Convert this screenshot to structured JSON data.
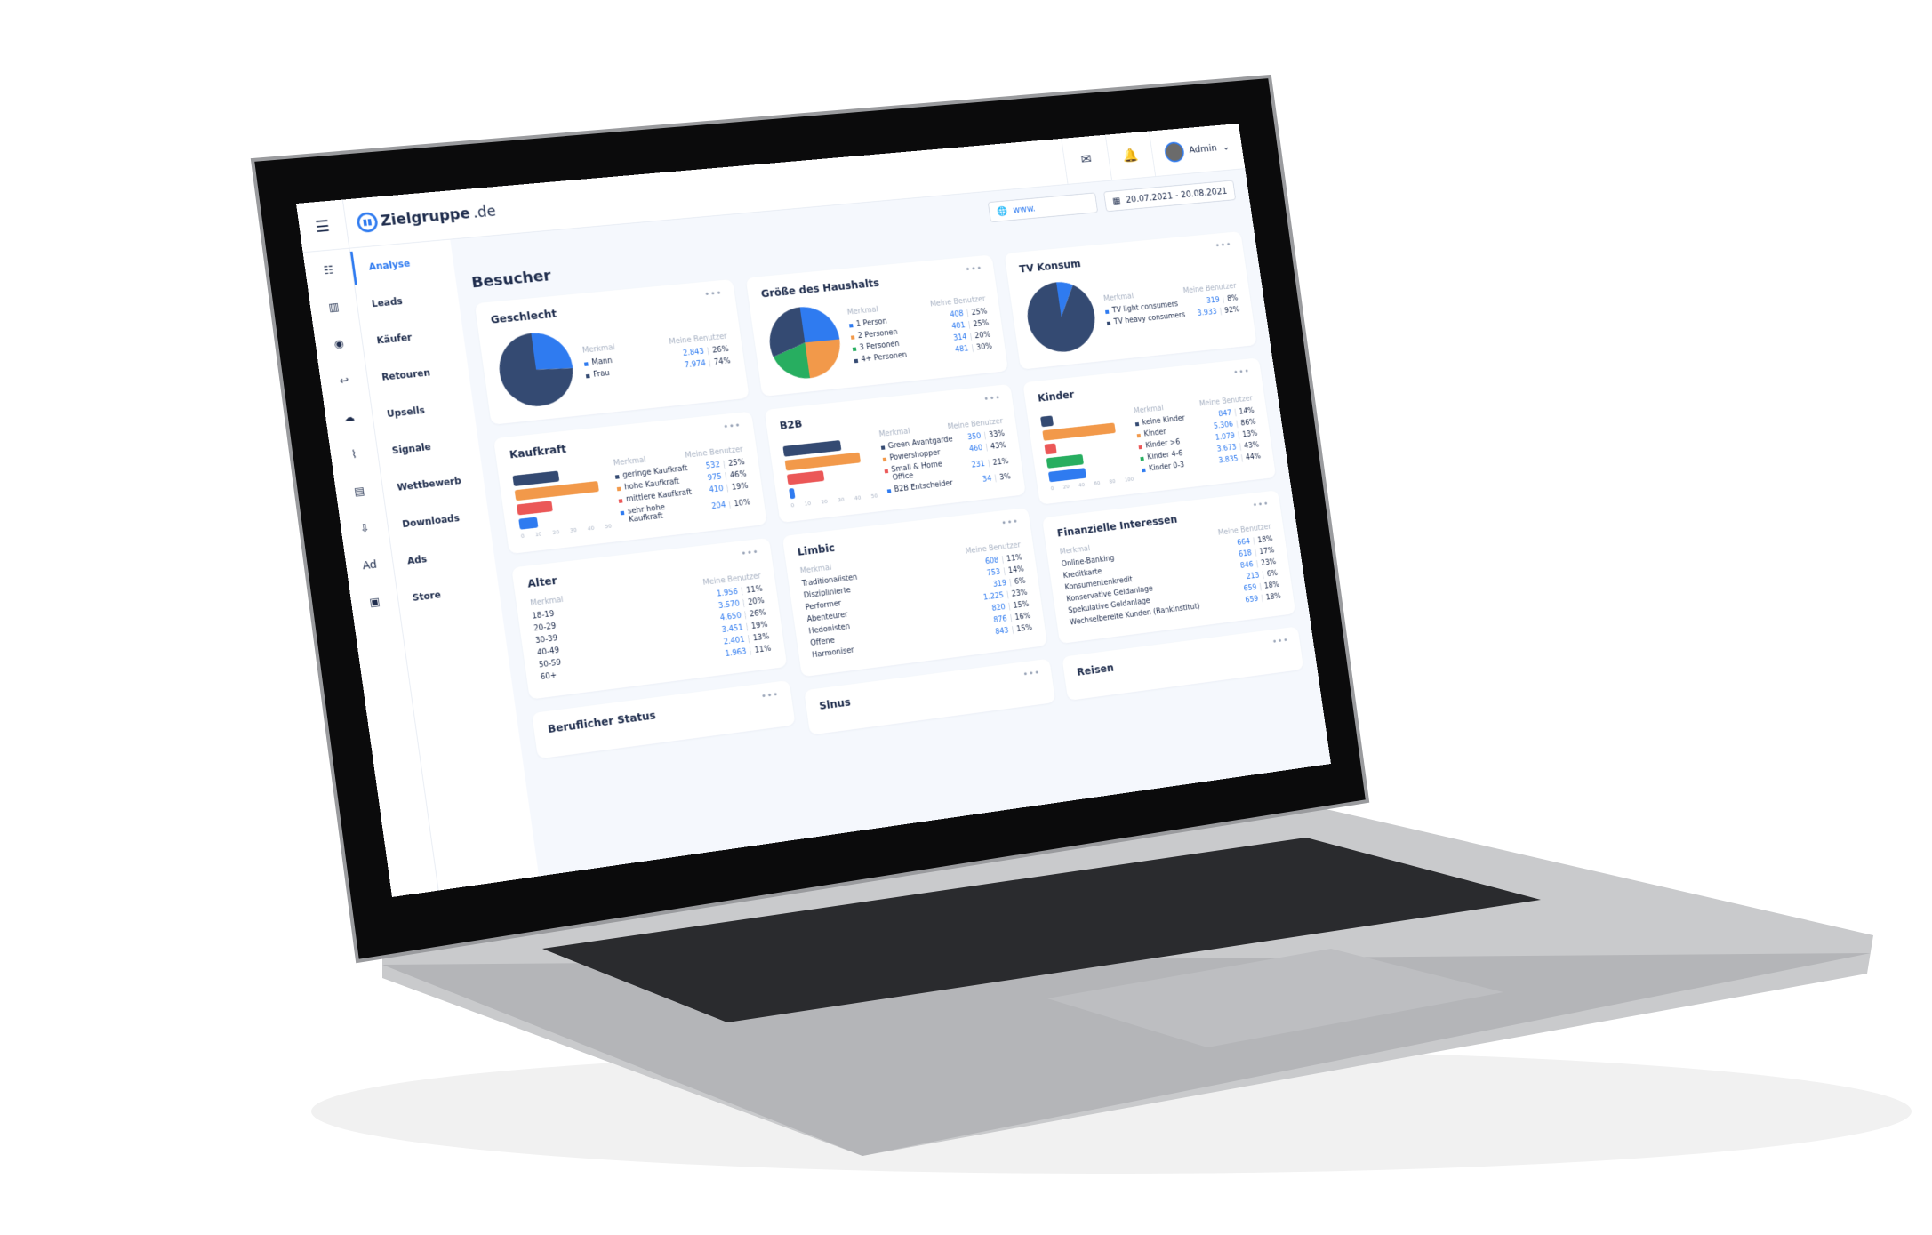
{
  "colors": {
    "navy": "#344a72",
    "blue": "#2f7bf0",
    "orange": "#f2994a",
    "green": "#27ae60",
    "red": "#eb5757"
  },
  "header": {
    "logo_name": "Zielgruppe",
    "logo_tld": ".de",
    "user": "Admin",
    "icons": [
      "menu-icon",
      "mail-icon",
      "bell-icon",
      "chevron-down-icon"
    ]
  },
  "filters": {
    "url_value": "www.",
    "date_range": "20.07.2021 - 20.08.2021"
  },
  "rail_icons": [
    "list-icon",
    "bar-chart-icon",
    "user-circle-icon",
    "return-icon",
    "cloud-icon",
    "signal-icon",
    "clipboard-icon",
    "download-icon",
    "ads-icon",
    "store-icon"
  ],
  "nav": [
    {
      "label": "Analyse",
      "active": true
    },
    {
      "label": "Leads"
    },
    {
      "label": "Käufer"
    },
    {
      "label": "Retouren"
    },
    {
      "label": "Upsells"
    },
    {
      "label": "Signale"
    },
    {
      "label": "Wettbewerb"
    },
    {
      "label": "Downloads"
    },
    {
      "label": "Ads"
    },
    {
      "label": "Store"
    }
  ],
  "page_title": "Besucher",
  "col_merkmal": "Merkmal",
  "col_users": "Meine Benutzer",
  "columns": [
    [
      {
        "title": "Geschlecht",
        "type": "pie",
        "rows": [
          {
            "label": "Mann",
            "count": "2.843",
            "pct": 26,
            "color": "blue"
          },
          {
            "label": "Frau",
            "count": "7.974",
            "pct": 74,
            "color": "navy"
          }
        ]
      },
      {
        "title": "Kaufkraft",
        "type": "bar",
        "ticks": [
          "0",
          "10",
          "20",
          "30",
          "40",
          "50"
        ],
        "max": 50,
        "rows": [
          {
            "label": "geringe Kaufkraft",
            "count": "532",
            "pct": 25,
            "color": "navy"
          },
          {
            "label": "hohe Kaufkraft",
            "count": "975",
            "pct": 46,
            "color": "orange"
          },
          {
            "label": "mittlere Kaufkraft",
            "count": "410",
            "pct": 19,
            "color": "red"
          },
          {
            "label": "sehr hohe Kaufkraft",
            "count": "204",
            "pct": 10,
            "color": "blue"
          }
        ]
      },
      {
        "title": "Alter",
        "type": "list",
        "rows": [
          {
            "label": "18-19",
            "count": "1.956",
            "pct": 11
          },
          {
            "label": "20-29",
            "count": "3.570",
            "pct": 20
          },
          {
            "label": "30-39",
            "count": "4.650",
            "pct": 26
          },
          {
            "label": "40-49",
            "count": "3.451",
            "pct": 19
          },
          {
            "label": "50-59",
            "count": "2.401",
            "pct": 13
          },
          {
            "label": "60+",
            "count": "1.963",
            "pct": 11
          }
        ]
      },
      {
        "title": "Beruflicher Status",
        "type": "empty",
        "rows": []
      }
    ],
    [
      {
        "title": "Größe des Haushalts",
        "type": "pie",
        "rows": [
          {
            "label": "1 Person",
            "count": "408",
            "pct": 25,
            "color": "blue"
          },
          {
            "label": "2 Personen",
            "count": "401",
            "pct": 25,
            "color": "orange"
          },
          {
            "label": "3 Personen",
            "count": "314",
            "pct": 20,
            "color": "green"
          },
          {
            "label": "4+ Personen",
            "count": "481",
            "pct": 30,
            "color": "navy"
          }
        ]
      },
      {
        "title": "B2B",
        "type": "bar",
        "ticks": [
          "0",
          "10",
          "20",
          "30",
          "40",
          "50"
        ],
        "max": 50,
        "rows": [
          {
            "label": "Green Avantgarde",
            "count": "350",
            "pct": 33,
            "color": "navy"
          },
          {
            "label": "Powershopper",
            "count": "460",
            "pct": 43,
            "color": "orange"
          },
          {
            "label": "Small & Home Office",
            "count": "231",
            "pct": 21,
            "color": "red"
          },
          {
            "label": "B2B Entscheider",
            "count": "34",
            "pct": 3,
            "color": "blue"
          }
        ]
      },
      {
        "title": "Limbic",
        "type": "list",
        "rows": [
          {
            "label": "Traditionalisten",
            "count": "608",
            "pct": 11
          },
          {
            "label": "Disziplinierte",
            "count": "753",
            "pct": 14
          },
          {
            "label": "Performer",
            "count": "319",
            "pct": 6
          },
          {
            "label": "Abenteurer",
            "count": "1.225",
            "pct": 23
          },
          {
            "label": "Hedonisten",
            "count": "820",
            "pct": 15
          },
          {
            "label": "Offene",
            "count": "876",
            "pct": 16
          },
          {
            "label": "Harmoniser",
            "count": "843",
            "pct": 15
          }
        ]
      },
      {
        "title": "Sinus",
        "type": "empty",
        "rows": []
      }
    ],
    [
      {
        "title": "TV Konsum",
        "type": "pie",
        "rows": [
          {
            "label": "TV light consumers",
            "count": "319",
            "pct": 8,
            "color": "blue"
          },
          {
            "label": "TV heavy consumers",
            "count": "3.933",
            "pct": 92,
            "color": "navy"
          }
        ]
      },
      {
        "title": "Kinder",
        "type": "bar",
        "ticks": [
          "0",
          "20",
          "40",
          "60",
          "80",
          "100"
        ],
        "max": 100,
        "rows": [
          {
            "label": "keine Kinder",
            "count": "847",
            "pct": 14,
            "color": "navy"
          },
          {
            "label": "Kinder",
            "count": "5.306",
            "pct": 86,
            "color": "orange"
          },
          {
            "label": "Kinder >6",
            "count": "1.079",
            "pct": 13,
            "color": "red"
          },
          {
            "label": "Kinder 4-6",
            "count": "3.673",
            "pct": 43,
            "color": "green"
          },
          {
            "label": "Kinder 0-3",
            "count": "3.835",
            "pct": 44,
            "color": "blue"
          }
        ]
      },
      {
        "title": "Finanzielle Interessen",
        "type": "list",
        "rows": [
          {
            "label": "Online-Banking",
            "count": "664",
            "pct": 18
          },
          {
            "label": "Kreditkarte",
            "count": "618",
            "pct": 17
          },
          {
            "label": "Konsumentenkredit",
            "count": "846",
            "pct": 23
          },
          {
            "label": "Konservative Geldanlage",
            "count": "213",
            "pct": 6
          },
          {
            "label": "Spekulative Geldanlage",
            "count": "659",
            "pct": 18
          },
          {
            "label": "Wechselbereite Kunden (Bankinstitut)",
            "count": "659",
            "pct": 18
          }
        ]
      },
      {
        "title": "Reisen",
        "type": "empty",
        "rows": []
      }
    ]
  ]
}
